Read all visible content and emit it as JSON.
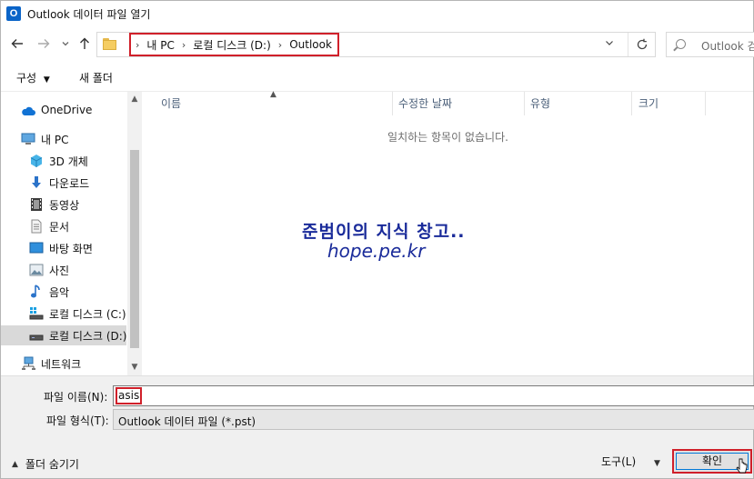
{
  "window": {
    "title": "Outlook 데이터 파일 열기",
    "app_icon_letter": "O"
  },
  "nav": {
    "back_icon": "arrow-left",
    "forward_icon": "arrow-right",
    "recent_icon": "chevron-down",
    "up_icon": "arrow-up",
    "breadcrumb": [
      "내 PC",
      "로컬 디스크 (D:)",
      "Outlook"
    ],
    "separator": "›",
    "refresh_icon": "refresh",
    "search_placeholder": "Outlook 검"
  },
  "commands": {
    "organize": "구성",
    "new_folder": "새 폴더"
  },
  "sidebar": {
    "items": [
      {
        "label": "OneDrive",
        "icon": "cloud-icon"
      },
      {
        "label": "내 PC",
        "icon": "computer-icon"
      },
      {
        "label": "3D 개체",
        "icon": "cube-icon"
      },
      {
        "label": "다운로드",
        "icon": "download-icon"
      },
      {
        "label": "동영상",
        "icon": "film-icon"
      },
      {
        "label": "문서",
        "icon": "document-icon"
      },
      {
        "label": "바탕 화면",
        "icon": "desktop-icon"
      },
      {
        "label": "사진",
        "icon": "picture-icon"
      },
      {
        "label": "음악",
        "icon": "music-icon"
      },
      {
        "label": "로컬 디스크 (C:)",
        "icon": "drive-icon"
      },
      {
        "label": "로컬 디스크 (D:)",
        "icon": "drive-icon"
      },
      {
        "label": "네트워크",
        "icon": "network-icon"
      }
    ]
  },
  "columns": [
    "이름",
    "수정한 날짜",
    "유형",
    "크기"
  ],
  "empty_message": "일치하는 항목이 없습니다.",
  "watermark": {
    "line1": "준범이의 지식 창고..",
    "line2": "hope.pe.kr"
  },
  "form": {
    "filename_label": "파일 이름(N):",
    "filename_value": "asis",
    "filetype_label": "파일 형식(T):",
    "filetype_value": "Outlook 데이터 파일 (*.pst)"
  },
  "footer": {
    "hide_folders": "폴더 숨기기",
    "tools": "도구(L)",
    "ok": "확인"
  },
  "colors": {
    "highlight_box": "#d0202a",
    "watermark": "#1a2b9a",
    "selected_nav": "#d9d9d9"
  }
}
